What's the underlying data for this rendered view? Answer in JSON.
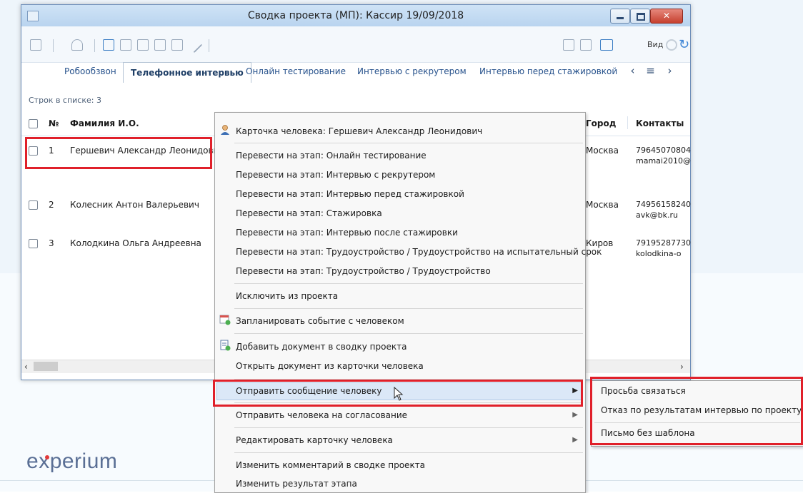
{
  "window": {
    "title": "Сводка проекта (МП): Кассир 19/09/2018"
  },
  "toolbar": {
    "view_label": "Вид"
  },
  "tabs": [
    {
      "label": "Робообзвон"
    },
    {
      "label": "Телефонное интервью"
    },
    {
      "label": "Онлайн тестирование"
    },
    {
      "label": "Интервью с рекрутером"
    },
    {
      "label": "Интервью перед стажировкой"
    }
  ],
  "grid": {
    "count_label": "Строк в списке: 3",
    "columns": [
      "№",
      "Фамилия И.О.",
      "Город",
      "Контакты"
    ],
    "rows": [
      {
        "num": "1",
        "name": "Гершевич Александр Леонидович",
        "city": "Москва",
        "contact1": "79645070804",
        "contact2": "mamai2010@"
      },
      {
        "num": "2",
        "name": "Колесник Антон Валерьевич",
        "city": "Москва",
        "contact1": "74956158240",
        "contact2": "avk@bk.ru"
      },
      {
        "num": "3",
        "name": "Колодкина Ольга Андреевна",
        "city": "Киров",
        "contact1": "79195287730",
        "contact2": "kolodkina-o"
      }
    ]
  },
  "context_menu": {
    "items": [
      "Карточка человека: Гершевич Александр Леонидович",
      "Перевести на этап: Онлайн тестирование",
      "Перевести на этап: Интервью с рекрутером",
      "Перевести на этап: Интервью перед стажировкой",
      "Перевести на этап: Стажировка",
      "Перевести на этап: Интервью после стажировки",
      "Перевести на этап: Трудоустройство / Трудоустройство на испытательный срок",
      "Перевести на этап: Трудоустройство / Трудоустройство",
      "Исключить из проекта",
      "Запланировать событие с человеком",
      "Добавить документ в сводку проекта",
      "Открыть документ из карточки человека",
      "Отправить сообщение человеку",
      "Отправить человека на согласование",
      "Редактировать карточку человека",
      "Изменить комментарий в сводке проекта",
      "Изменить результат этапа"
    ]
  },
  "submenu": {
    "items": [
      "Просьба связаться",
      "Отказ по результатам интервью по проекту",
      "Письмо без шаблона"
    ]
  },
  "brand": {
    "logo_prefix": "e",
    "logo_x": "x",
    "logo_suffix": "perium"
  },
  "colors": {
    "highlight_red": "#e0202a",
    "accent_blue": "#3d7fc4",
    "logo": "#5a6f95"
  }
}
